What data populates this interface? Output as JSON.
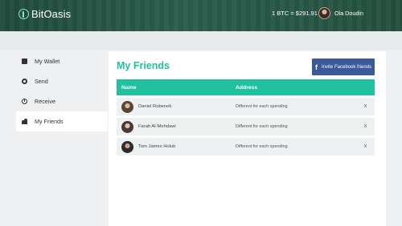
{
  "header": {
    "brand": "BitOasis",
    "rate": "1 BTC = $291.91",
    "user_name": "Ola Doudin"
  },
  "sidebar": {
    "items": [
      {
        "label": "My Wallet",
        "icon": "wallet-icon",
        "active": false
      },
      {
        "label": "Send",
        "icon": "send-icon",
        "active": false
      },
      {
        "label": "Receive",
        "icon": "receive-icon",
        "active": false
      },
      {
        "label": "My Friends",
        "icon": "friends-icon",
        "active": true
      }
    ]
  },
  "main": {
    "title": "My Friends",
    "invite_button": "Invite Facebook friends",
    "table": {
      "columns": [
        "Name",
        "Address"
      ],
      "rows": [
        {
          "name": "Daniel Robenek",
          "address": "Different for each spending",
          "remove": "X"
        },
        {
          "name": "Farah Al-Mehdawi",
          "address": "Different for each spending",
          "remove": "X"
        },
        {
          "name": "Tom James Holub",
          "address": "Different for each spending",
          "remove": "X"
        }
      ]
    }
  },
  "colors": {
    "accent": "#20c19e",
    "header": "#2b5d4c",
    "facebook": "#3b5998"
  }
}
